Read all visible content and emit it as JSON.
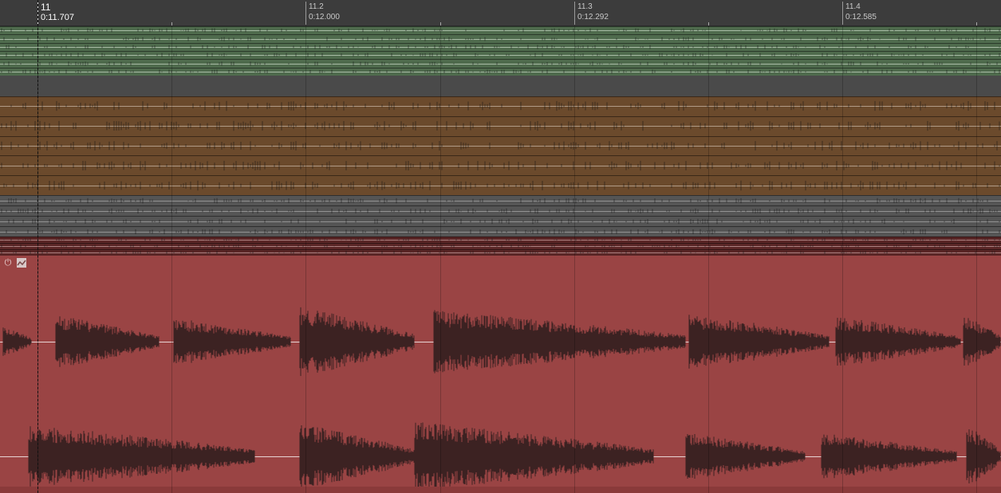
{
  "ruler": {
    "markers": [
      {
        "bar": "11",
        "time": "0:11.707"
      },
      {
        "bar": "11.2",
        "time": "0:12.000"
      },
      {
        "bar": "11.3",
        "time": "0:12.292"
      },
      {
        "bar": "11.4",
        "time": "0:12.585"
      }
    ]
  },
  "tracks": [
    {
      "name": "green-track",
      "color": "#4f6b4d",
      "line_color": "#c8d8c4",
      "lanes": 6
    },
    {
      "name": "gray-divider-track",
      "color": "#4a4a4a"
    },
    {
      "name": "brown-track",
      "color": "#6b4a2c",
      "line_color": "#c9b6a4",
      "lanes": 5
    },
    {
      "name": "gray-wave-track",
      "color": "#555555",
      "line_color": "#a8a8a8",
      "lanes": 4
    },
    {
      "name": "dark-red-track",
      "color": "#5a2626",
      "line_color": "#c9a0a0",
      "lanes": 3
    },
    {
      "name": "red-audio-track",
      "color": "#9a4444",
      "line_color": "#e8d6d6",
      "wave_color": "#3c2222",
      "channels": 2
    }
  ],
  "icons": {
    "power": "power-icon",
    "envelope": "clip-envelope-icon"
  }
}
